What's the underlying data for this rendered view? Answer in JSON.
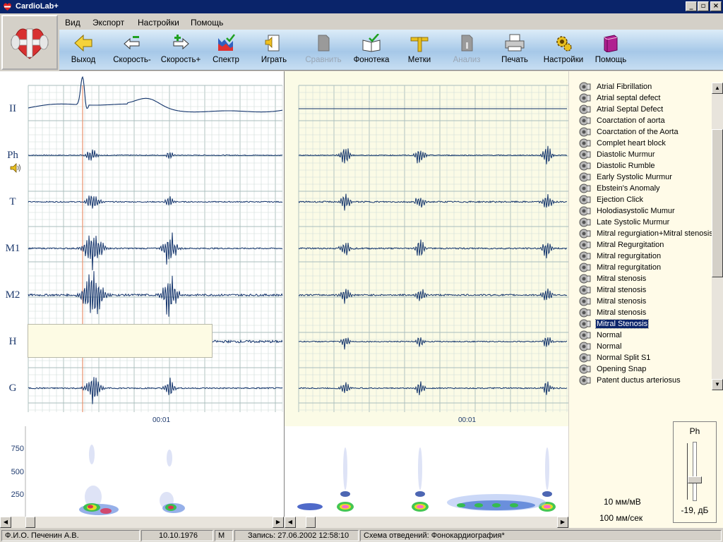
{
  "window": {
    "title": "CardioLab+"
  },
  "menu": [
    "Вид",
    "Экспорт",
    "Настройки",
    "Помощь"
  ],
  "toolbar": [
    {
      "label": "Выход",
      "icon": "exit-arrow-icon",
      "enabled": true
    },
    {
      "label": "Скорость-",
      "icon": "speed-down-icon",
      "enabled": true
    },
    {
      "label": "Скорость+",
      "icon": "speed-up-icon",
      "enabled": true
    },
    {
      "label": "Спектр",
      "icon": "spectrum-icon",
      "enabled": true
    },
    {
      "label": "Играть",
      "icon": "play-icon",
      "enabled": true
    },
    {
      "label": "Сравнить",
      "icon": "compare-icon",
      "enabled": false
    },
    {
      "label": "Фонотека",
      "icon": "phonotheque-icon",
      "enabled": true
    },
    {
      "label": "Метки",
      "icon": "marks-icon",
      "enabled": true
    },
    {
      "label": "Анализ",
      "icon": "analysis-icon",
      "enabled": false
    },
    {
      "label": "Печать",
      "icon": "printer-icon",
      "enabled": true
    },
    {
      "label": "Настройки",
      "icon": "settings-icon",
      "enabled": true
    },
    {
      "label": "Помощь",
      "icon": "help-book-icon",
      "enabled": true
    }
  ],
  "leads": [
    "II",
    "Ph",
    "T",
    "M1",
    "M2",
    "H",
    "G"
  ],
  "time_labels": [
    "00:01",
    "00:01"
  ],
  "spectrum_freq_labels": [
    "750",
    "500",
    "250"
  ],
  "library": {
    "items": [
      "Atrial Fibrillation",
      "Atrial septal defect",
      "Atrial Septal Defect",
      "Coarctation of aorta",
      "Coarctation of the Aorta",
      "Complet heart block",
      "Diastolic Murmur",
      "Diastolic Rumble",
      "Early Systolic Murmur",
      "Ebstein's Anomaly",
      "Ejection Click",
      "Holodiasystolic Mumur",
      "Late Systolic Murmur",
      "Mitral regurgiation+Mitral stenosis",
      "Mitral Regurgitation",
      "Mitral regurgitation",
      "Mitral regurgitation",
      "Mitral stenosis",
      "Mitral stenosis",
      "Mitral stenosis",
      "Mitral stenosis",
      "Mitral Stenosis",
      "Normal",
      "Normal",
      "Normal Split S1",
      "Opening Snap",
      "Patent ductus arteriosus"
    ],
    "selected": "Mitral Stenosis"
  },
  "scales": {
    "amplitude": "10 мм/мВ",
    "speed": "100 мм/сек"
  },
  "volume": {
    "channel": "Ph",
    "value": "-19, дБ"
  },
  "status": {
    "name": "Ф.И.О. Печенин А.В.",
    "dob": "10.10.1976",
    "sex": "М",
    "recording": "Запись: 27.06.2002 12:58:10",
    "scheme": "Схема отведений: Фонокардиография*"
  },
  "colors": {
    "title_bar": "#0a246a",
    "waveform": "#12336b",
    "grid": "#cfdcd8",
    "grid_major": "#a9bdbc",
    "panel_yellow": "#fbfbe6",
    "marker": "#e8916e",
    "selection": "#0a246a"
  }
}
